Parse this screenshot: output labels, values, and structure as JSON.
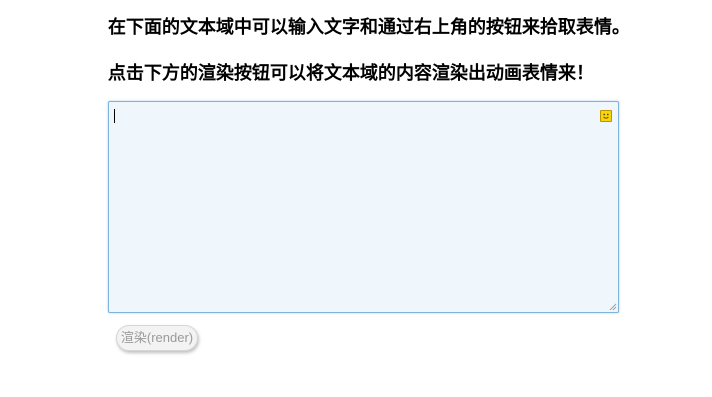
{
  "instructions": {
    "line1": "在下面的文本域中可以输入文字和通过右上角的按钮来拾取表情。",
    "line2": "点击下方的渲染按钮可以将文本域的内容渲染出动画表情来！"
  },
  "editor": {
    "value": "",
    "emoji_button_icon": "smiley-face-icon"
  },
  "render_button": {
    "label": "渲染(render)",
    "state": "disabled"
  },
  "colors": {
    "editor_background": "#eff7fd",
    "editor_border": "#7fb5dd",
    "emoji_button": "#f5d60b",
    "button_text_disabled": "#9a9a9a"
  }
}
